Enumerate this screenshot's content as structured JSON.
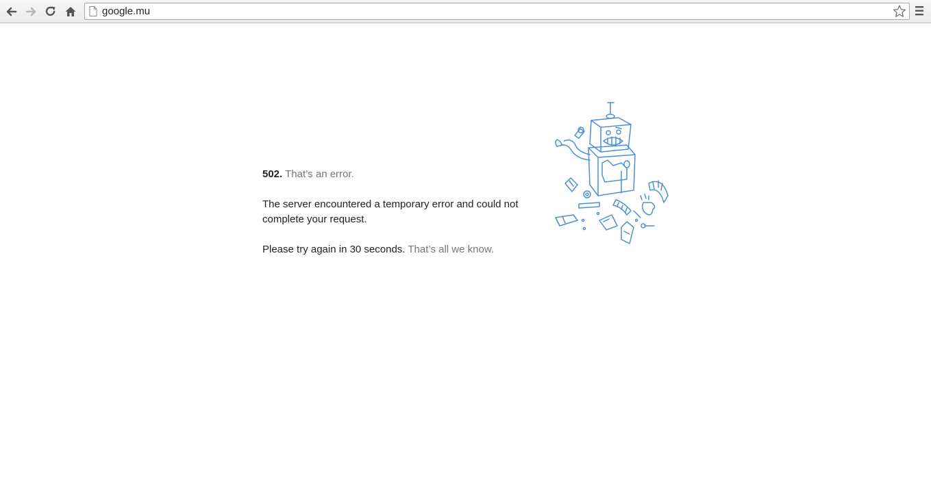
{
  "browser": {
    "url": "google.mu",
    "icons": {
      "back": "back-arrow-icon",
      "forward": "forward-arrow-icon",
      "reload": "reload-icon",
      "home": "home-icon",
      "page": "page-icon",
      "bookmark": "star-icon",
      "menu": "hamburger-menu-icon"
    }
  },
  "error": {
    "code": "502.",
    "title": "That’s an error.",
    "message": "The server encountered a temporary error and could not complete your request.",
    "retry": "Please try again in 30 seconds.",
    "trailer": "That’s all we know."
  },
  "colors": {
    "text": "#222222",
    "muted": "#777777",
    "robot": "#4a90d9"
  }
}
